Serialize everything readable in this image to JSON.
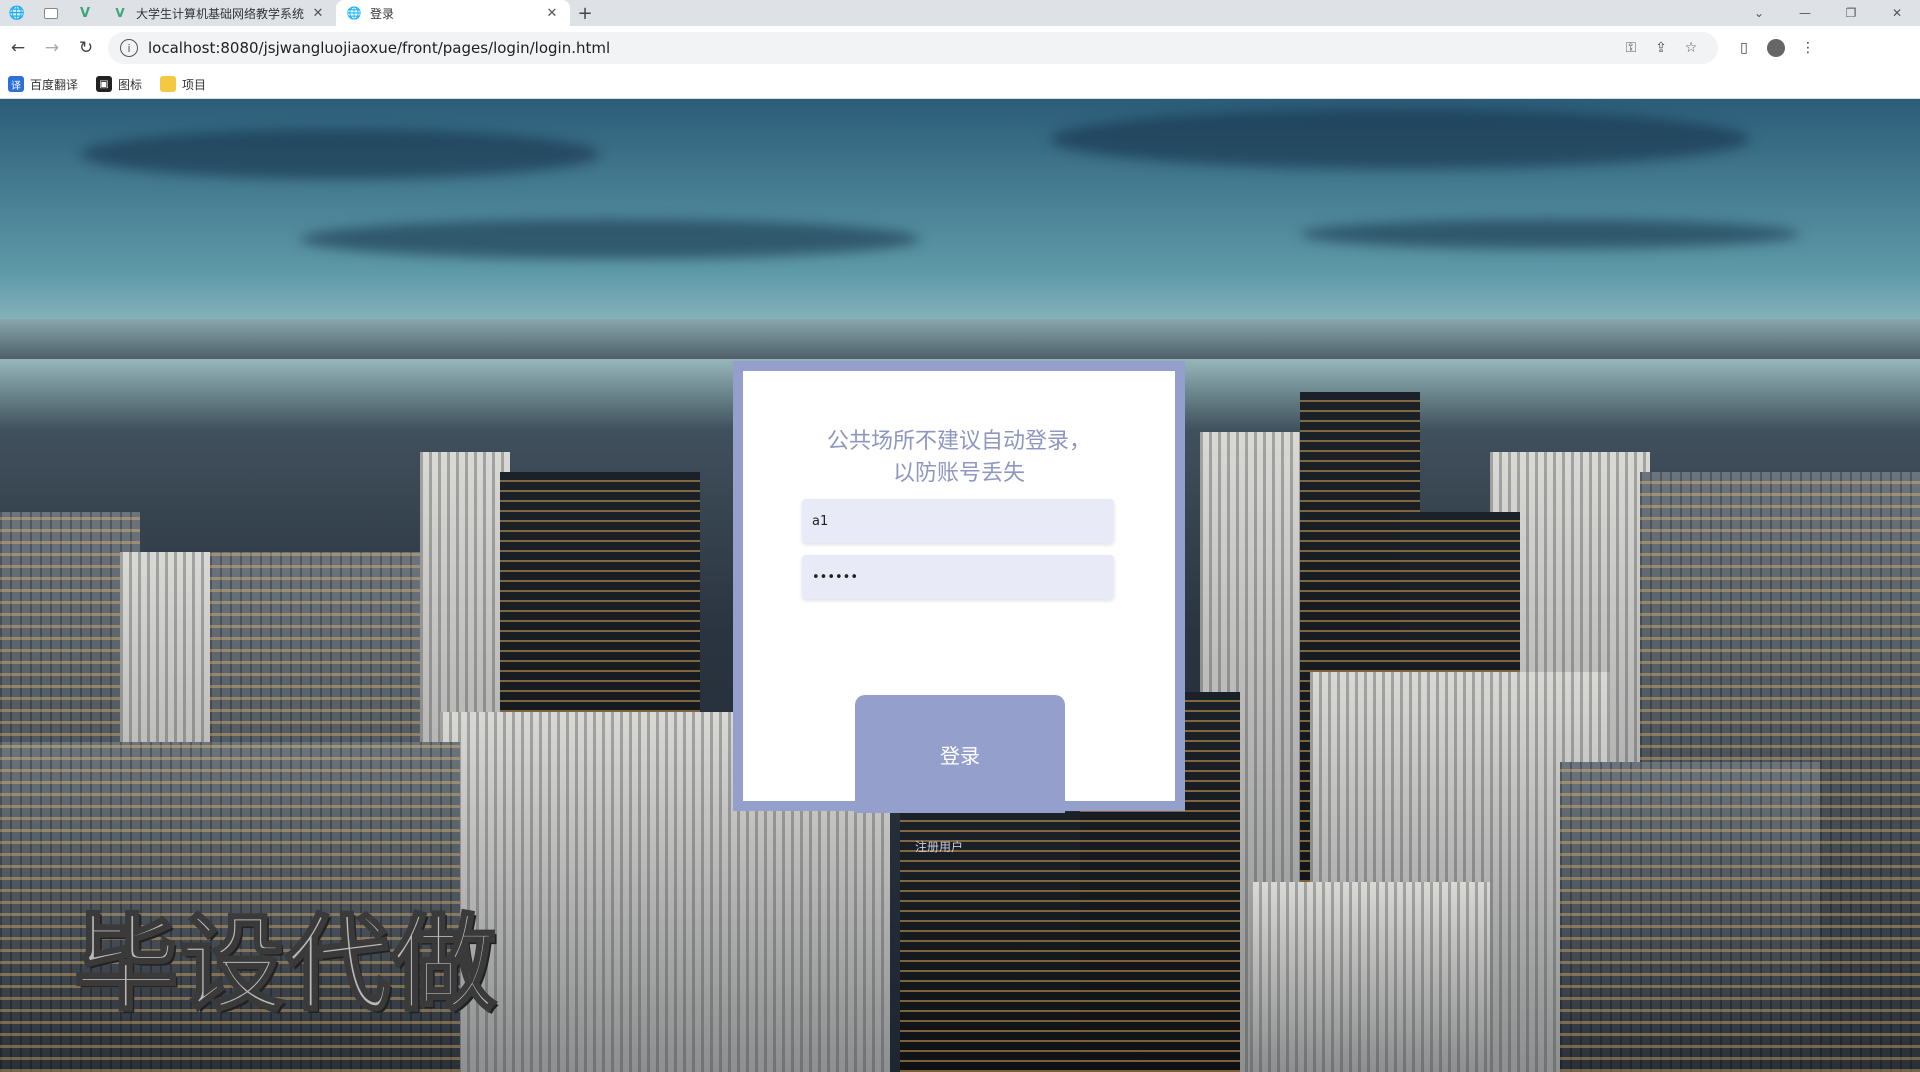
{
  "browser": {
    "tabs": [
      {
        "title": "大学生计算机基础网络教学系统",
        "active": false
      },
      {
        "title": "登录",
        "active": true
      }
    ],
    "new_tab": "+",
    "window_controls": [
      "⌄",
      "—",
      "❐",
      "✕"
    ],
    "url": "localhost:8080/jsjwangluojiaoxue/front/pages/login/login.html",
    "bookmarks": [
      {
        "label": "百度翻译",
        "icon": "baidu-translate-icon"
      },
      {
        "label": "图标",
        "icon": "image-icon"
      },
      {
        "label": "项目",
        "icon": "folder-icon"
      }
    ]
  },
  "login": {
    "tip_line1": "公共场所不建议自动登录，",
    "tip_line2": "以防账号丢失",
    "username_value": "a1",
    "password_value": "••••••",
    "login_button": "登录",
    "register_link": "注册用户"
  },
  "watermark": "毕设代做",
  "colors": {
    "accent": "#959fcc",
    "tip_text": "#8f97c0",
    "field_bg": "#e8ebf7"
  }
}
